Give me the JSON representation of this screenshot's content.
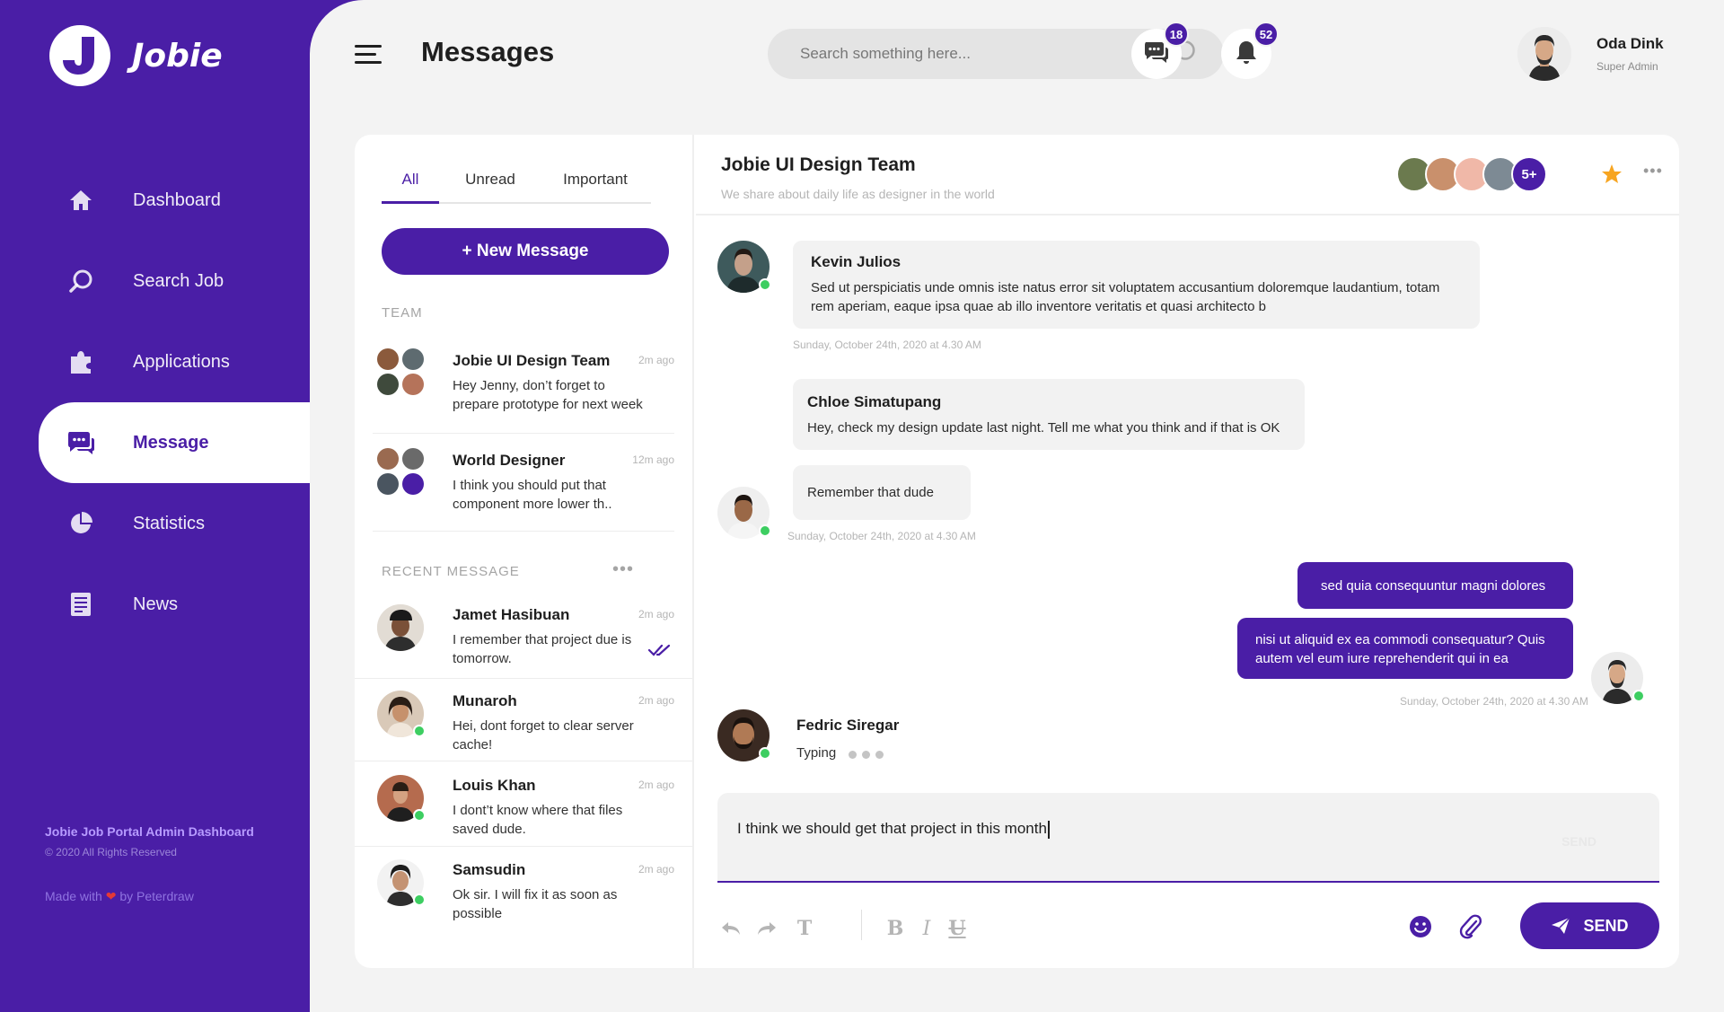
{
  "brand": {
    "name": "Jobie"
  },
  "sidebar": {
    "items": [
      {
        "label": "Dashboard",
        "icon": "home-icon"
      },
      {
        "label": "Search Job",
        "icon": "search-icon"
      },
      {
        "label": "Applications",
        "icon": "puzzle-icon"
      },
      {
        "label": "Message",
        "icon": "chat-icon",
        "active": true
      },
      {
        "label": "Statistics",
        "icon": "pie-chart-icon"
      },
      {
        "label": "News",
        "icon": "document-icon"
      }
    ],
    "footer": {
      "title": "Jobie Job Portal Admin Dashboard",
      "copyright": "© 2020 All Rights Reserved",
      "made_prefix": "Made with",
      "made_suffix": "by Peterdraw"
    }
  },
  "header": {
    "title": "Messages",
    "search_placeholder": "Search something here...",
    "messages_badge": "18",
    "notifications_badge": "52",
    "user": {
      "name": "Oda Dink",
      "role": "Super Admin"
    }
  },
  "inbox": {
    "tabs": [
      "All",
      "Unread",
      "Important"
    ],
    "active_tab": "All",
    "new_message_label": "+ New Message",
    "team_label": "TEAM",
    "recent_label": "RECENT MESSAGE",
    "team": [
      {
        "name": "Jobie UI Design Team",
        "time": "2m ago",
        "preview": "Hey Jenny, don’t forget to prepare prototype for next week"
      },
      {
        "name": "World Designer",
        "time": "12m ago",
        "preview": "I think you should put that component more lower th.."
      }
    ],
    "recent": [
      {
        "name": "Jamet Hasibuan",
        "time": "2m ago",
        "preview": "I remember that project due is tomorrow.",
        "read": true
      },
      {
        "name": "Munaroh",
        "time": "2m ago",
        "preview": "Hei, dont forget to clear server cache!",
        "online": true
      },
      {
        "name": "Louis Khan",
        "time": "2m ago",
        "preview": "I dont’t know where that files saved dude.",
        "online": true
      },
      {
        "name": "Samsudin",
        "time": "2m ago",
        "preview": "Ok sir. I will fix it as soon as possible",
        "online": true
      }
    ]
  },
  "chat": {
    "title": "Jobie UI Design Team",
    "subtitle": "We share about daily life as designer in the world",
    "members_more": "5+",
    "messages": [
      {
        "sender": "Kevin Julios",
        "text": "Sed ut perspiciatis unde omnis iste natus error sit voluptatem accusantium doloremque laudantium, totam rem aperiam, eaque ipsa quae ab illo inventore veritatis et quasi architecto b",
        "stamp": "Sunday, October 24th, 2020  at 4.30 AM"
      },
      {
        "sender": "Chloe Simatupang",
        "text": "Hey, check my design update last night. Tell me what you think and if that is OK"
      },
      {
        "text": "Remember that dude",
        "stamp": "Sunday, October 24th, 2020  at 4.30 AM"
      },
      {
        "text": "sed quia consequuntur magni dolores",
        "outgoing": true
      },
      {
        "text": "nisi ut aliquid ex ea commodi consequatur? Quis autem vel eum iure reprehenderit qui in ea",
        "outgoing": true,
        "stamp": "Sunday, October 24th, 2020  at 4.30 AM"
      }
    ],
    "typing": {
      "name": "Fedric Siregar",
      "label": "Typing"
    },
    "composer_value": "I think we should get that project in this month",
    "composer_ghost": "SEND",
    "send_label": "SEND"
  },
  "colors": {
    "primary": "#4A1EA6",
    "online": "#3DCE61",
    "star": "#F7A521"
  }
}
